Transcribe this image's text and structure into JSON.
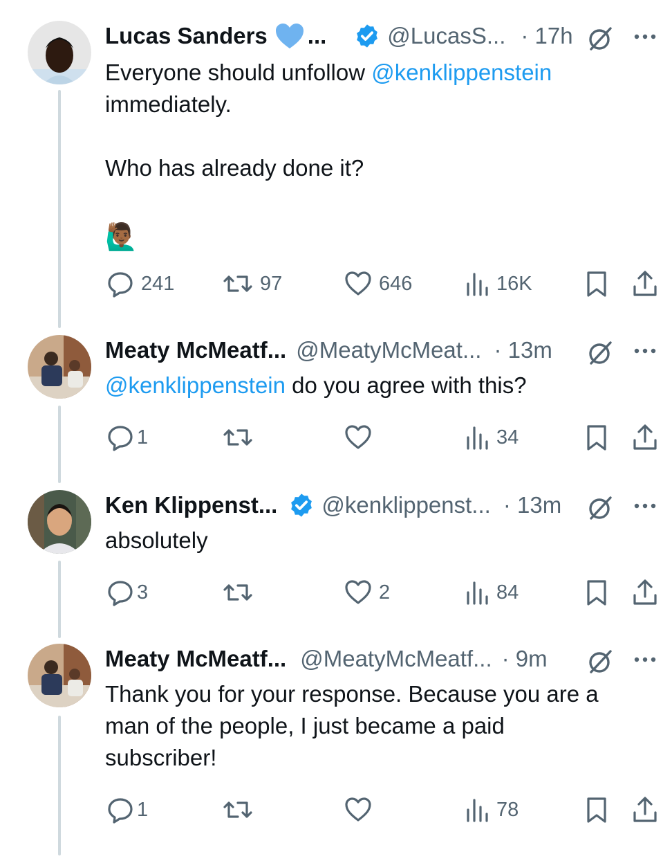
{
  "colors": {
    "link": "#1d9bf0",
    "text": "#0f1419",
    "muted": "#536471",
    "verified": "#1d9bf0",
    "heart_badge": "#6fb3f0",
    "thread_line": "#cfd9de"
  },
  "tweets": [
    {
      "name": "Lucas Sanders",
      "name_suffix": "...",
      "handle": "@LucasS...",
      "time": "· 17h",
      "emoji": "🙋🏾‍♂️",
      "line1_pre": "Everyone should unfollow ",
      "line1_mention": "@kenklippenstein",
      "line2": "immediately.",
      "line3": "Who has already done it?",
      "stats": {
        "replies": "241",
        "reposts": "97",
        "likes": "646",
        "views": "16K"
      }
    },
    {
      "name": "Meaty McMeatf...",
      "handle": "@MeatyMcMeat...",
      "time": "· 13m",
      "mention": "@kenklippenstein",
      "text": " do you agree with this?",
      "stats": {
        "replies": "1",
        "reposts": "",
        "likes": "",
        "views": "34"
      }
    },
    {
      "name": "Ken Klippenst...",
      "handle": "@kenklippenst...",
      "time": "· 13m",
      "text": "absolutely",
      "stats": {
        "replies": "3",
        "reposts": "",
        "likes": "2",
        "views": "84"
      }
    },
    {
      "name": "Meaty McMeatf...",
      "handle": "@MeatyMcMeatf...",
      "time": "· 9m",
      "line1": "Thank you for your response. Because you are a",
      "line2": "man of the people, I just became a paid",
      "line3": "subscriber!",
      "stats": {
        "replies": "1",
        "reposts": "",
        "likes": "",
        "views": "78"
      }
    }
  ]
}
